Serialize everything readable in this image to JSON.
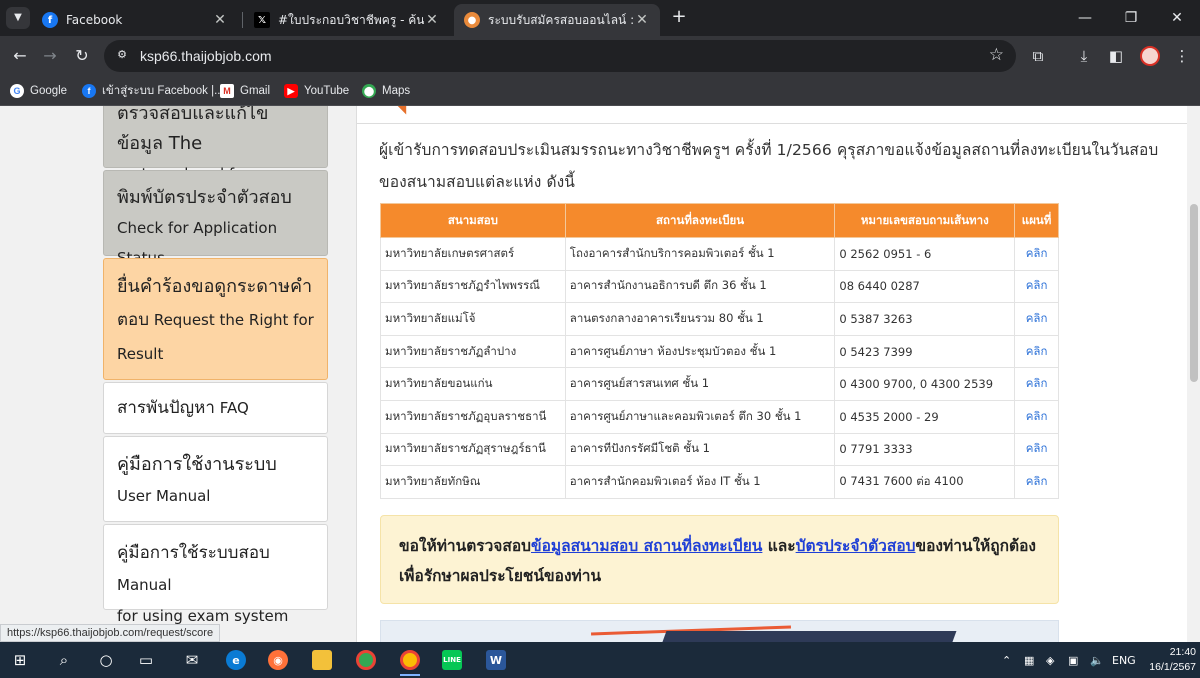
{
  "browser": {
    "tabs": [
      {
        "title": "Facebook",
        "icon": "facebook-icon"
      },
      {
        "title": "#ใบประกอบวิชาชีพครู - ค้นหา / X",
        "icon": "x-logo-icon"
      },
      {
        "title": "ระบบรับสมัครสอบออนไลน์ :: สำนักงาน",
        "icon": "site-favicon-icon"
      }
    ],
    "new_tab_symbol": "+",
    "url": "ksp66.thaijobjob.com",
    "bookmarks": [
      {
        "label": "Google",
        "icon": "google-icon"
      },
      {
        "label": "เข้าสู่ระบบ Facebook |...",
        "icon": "facebook-icon"
      },
      {
        "label": "Gmail",
        "icon": "gmail-icon"
      },
      {
        "label": "YouTube",
        "icon": "youtube-icon"
      },
      {
        "label": "Maps",
        "icon": "maps-icon"
      }
    ],
    "status_url": "https://ksp66.thaijobjob.com/request/score"
  },
  "sidebar": {
    "items": [
      {
        "th": "ตรวจสอบและแก้ไขข้อมูล The",
        "en": "system closed for renovation",
        "style": "gray"
      },
      {
        "th": "พิมพ์บัตรประจำตัวสอบ",
        "en": "Check for Application Status",
        "style": "gray"
      },
      {
        "th": "ยื่นคำร้องขอดูกระดาษคำ",
        "th2": "ตอบ",
        "en": "Request the Right for Result",
        "style": "orange"
      },
      {
        "th": "สารพันปัญหา",
        "en": "FAQ",
        "style": "white"
      },
      {
        "th": "คู่มือการใช้งานระบบ",
        "en": "User Manual",
        "style": "white"
      },
      {
        "th": "คู่มือการใช้ระบบสอบ",
        "en": "Manual",
        "en2": "for using exam system",
        "style": "white"
      }
    ]
  },
  "main": {
    "intro": "ผู้เข้ารับการทดสอบประเมินสมรรถนะทางวิชาชีพครูฯ ครั้งที่ 1/2566 คุรุสภาขอแจ้งข้อมูลสถานที่ลงทะเบียนในวันสอบของสนามสอบแต่ละแห่ง ดังนี้",
    "table": {
      "headers": [
        "สนามสอบ",
        "สถานที่ลงทะเบียน",
        "หมายเลขสอบถามเส้นทาง",
        "แผนที่"
      ],
      "rows": [
        [
          "มหาวิทยาลัยเกษตรศาสตร์",
          "โถงอาคารสำนักบริการคอมพิวเตอร์ ชั้น 1",
          "0 2562 0951 - 6",
          "คลิก"
        ],
        [
          "มหาวิทยาลัยราชภัฏรำไพพรรณี",
          "อาคารสำนักงานอธิการบดี ตึก 36 ชั้น 1",
          "08 6440 0287",
          "คลิก"
        ],
        [
          "มหาวิทยาลัยแม่โจ้",
          "ลานตรงกลางอาคารเรียนรวม 80 ชั้น 1",
          "0 5387 3263",
          "คลิก"
        ],
        [
          "มหาวิทยาลัยราชภัฏลำปาง",
          "อาคารศูนย์ภาษา ห้องประชุมบัวตอง ชั้น 1",
          "0 5423 7399",
          "คลิก"
        ],
        [
          "มหาวิทยาลัยขอนแก่น",
          "อาคารศูนย์สารสนเทศ ชั้น 1",
          "0 4300 9700, 0 4300 2539",
          "คลิก"
        ],
        [
          "มหาวิทยาลัยราชภัฏอุบลราชธานี",
          "อาคารศูนย์ภาษาและคอมพิวเตอร์ ตึก 30 ชั้น 1",
          "0 4535 2000 - 29",
          "คลิก"
        ],
        [
          "มหาวิทยาลัยราชภัฏสุราษฎร์ธานี",
          "อาคารทีปังกรรัศมีโชติ ชั้น 1",
          "0 7791 3333",
          "คลิก"
        ],
        [
          "มหาวิทยาลัยทักษิณ",
          "อาคารสำนักคอมพิวเตอร์ ห้อง IT ชั้น 1",
          "0 7431 7600 ต่อ 4100",
          "คลิก"
        ]
      ]
    },
    "notice": {
      "pre": "ขอให้ท่านตรวจสอบ",
      "link1": "ข้อมูลสนามสอบ สถานที่ลงทะเบียน",
      "mid": " และ",
      "link2": "บัตรประจำตัวสอบ",
      "post": "ของท่านให้ถูกต้อง เพื่อรักษาผลประโยชน์ของท่าน"
    }
  },
  "taskbar": {
    "apps": [
      "windows-start-icon",
      "search-icon",
      "cortana-icon",
      "task-view-icon",
      "mail-icon",
      "edge-icon",
      "firefox-icon",
      "file-explorer-icon",
      "chrome-icon",
      "chrome-profile-icon",
      "line-icon",
      "word-icon"
    ],
    "language": "ENG",
    "time": "21:40",
    "date": "16/1/2567"
  },
  "colors": {
    "table_header": "#f58a2c",
    "sidebar_active": "#fdd5a4",
    "sidebar_disabled": "#c9c9c4",
    "notice_bg": "#fdf3d3",
    "link": "#1f3fd6"
  }
}
